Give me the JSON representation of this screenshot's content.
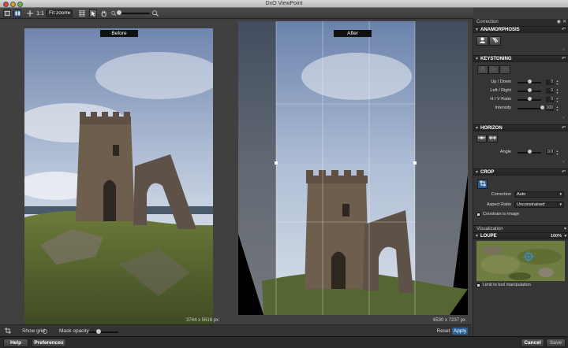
{
  "window": {
    "title": "DxO ViewPoint"
  },
  "toolbar": {
    "zoom_1_1": "1:1",
    "zoom_mode": "Fit zoom"
  },
  "viewer": {
    "before_label": "Before",
    "after_label": "After",
    "before_dims": "3744 x 5616 px",
    "after_dims": "6530 x 7237 px"
  },
  "bottombar": {
    "show_grid": "Show grid",
    "mask_opacity": "Mask opacity",
    "reset": "Reset",
    "apply": "Apply"
  },
  "footer": {
    "help": "Help",
    "preferences": "Preferences",
    "cancel": "Cancel",
    "save": "Save"
  },
  "panel": {
    "title": "Correction",
    "anamorphosis": {
      "title": "ANAMORPHOSIS"
    },
    "keystoning": {
      "title": "KEYSTONING",
      "rows": [
        {
          "label": "Up / Down",
          "value": "0"
        },
        {
          "label": "Left / Right",
          "value": "0"
        },
        {
          "label": "H / V Ratio",
          "value": "0"
        },
        {
          "label": "Intensity",
          "value": "100"
        }
      ]
    },
    "horizon": {
      "title": "HORIZON",
      "angle_label": "Angle",
      "angle_value": "0.0"
    },
    "crop": {
      "title": "CROP",
      "correction_label": "Correction",
      "correction_value": "Auto",
      "ratio_label": "Aspect Ratio",
      "ratio_value": "Unconstrained",
      "constrain": "Constrain to image"
    },
    "visualization": {
      "title": "Visualization",
      "loupe": "LOUPE",
      "loupe_zoom": "100%",
      "limit": "Limit to tool manipulation"
    }
  },
  "colors": {
    "accent": "#2c5f97"
  }
}
